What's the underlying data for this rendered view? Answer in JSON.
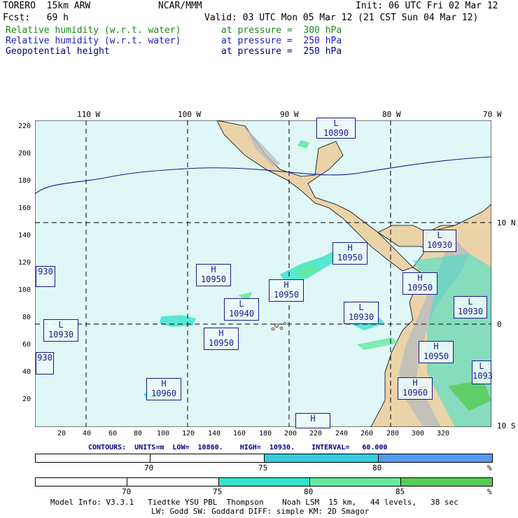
{
  "header": {
    "model": "TORERO  15km ARW",
    "center": "NCAR/MMM",
    "init": "Init: 06 UTC Fri 02 Mar 12",
    "fcst": "Fcst:   69 h",
    "valid": "Valid: 03 UTC Mon 05 Mar 12 (21 CST Sun 04 Mar 12)",
    "fields": [
      {
        "name": "Relative humidity (w.r.t. water)",
        "level": "at pressure =  300 hPa",
        "color": "#1a8a1a"
      },
      {
        "name": "Relative humidity (w.r.t. water)",
        "level": "at pressure =  250 hPa",
        "color": "#1a1ac8"
      },
      {
        "name": "Geopotential height",
        "level": "at pressure =  250 hPa",
        "color": "#000080"
      }
    ]
  },
  "map": {
    "lon_labels": [
      "110 W",
      "100 W",
      "90 W",
      "80 W",
      "70 W"
    ],
    "lat_labels": [
      "10 N",
      "0",
      "10 S"
    ],
    "y_ticks": [
      "220",
      "200",
      "180",
      "160",
      "140",
      "120",
      "100",
      "80",
      "60",
      "40",
      "20"
    ],
    "x_ticks": [
      "20",
      "40",
      "60",
      "80",
      "100",
      "120",
      "140",
      "160",
      "180",
      "200",
      "220",
      "240",
      "260",
      "280",
      "300",
      "320"
    ],
    "colors": {
      "ocean": "#dff7f7",
      "land": "#ebd3a9",
      "mountain": "#bdbdbd",
      "grid": "#000000"
    },
    "highs_lows": [
      {
        "type": "L",
        "value": "10890"
      },
      {
        "type": "H",
        "value": "10950"
      },
      {
        "type": "L",
        "value": "10930"
      },
      {
        "type": "H",
        "value": "10950"
      },
      {
        "type": "H",
        "value": "10950"
      },
      {
        "type": "H",
        "value": "10950"
      },
      {
        "type": "L",
        "value": "10930"
      },
      {
        "type": "L",
        "value": "10940"
      },
      {
        "type": "L",
        "value": "10930"
      },
      {
        "type": "L",
        "value": "10930"
      },
      {
        "type": "H",
        "value": "10950"
      },
      {
        "type": "H",
        "value": "10950"
      },
      {
        "type": "H",
        "value": "10960"
      },
      {
        "type": "H",
        "value": "10960"
      },
      {
        "type": "H",
        "value": ""
      },
      {
        "type": "",
        "value": "930"
      },
      {
        "type": "",
        "value": "930"
      },
      {
        "type": "L",
        "value": "1093"
      }
    ]
  },
  "contours": "CONTOURS:  UNITS=m  LOW=  10860.    HIGH=  10930.    INTERVAL=   60.000",
  "bar1": {
    "labels": [
      "70",
      "75",
      "80",
      "%"
    ],
    "colors": [
      "#ffffff",
      "#33ccdd",
      "#5599ee"
    ]
  },
  "bar2": {
    "labels": [
      "70",
      "75",
      "80",
      "85",
      "%"
    ],
    "colors": [
      "#ffffff",
      "#33e3cc",
      "#66e8a0",
      "#55cc55"
    ]
  },
  "footer": {
    "line1": "Model Info: V3.3.1   Tiedtke YSU PBL  Thompson    Noah LSM  15 km,   44 levels,   38 sec",
    "line2": "LW: Godd SW: Goddard DIFF: simple KM: 2D Smagor"
  }
}
